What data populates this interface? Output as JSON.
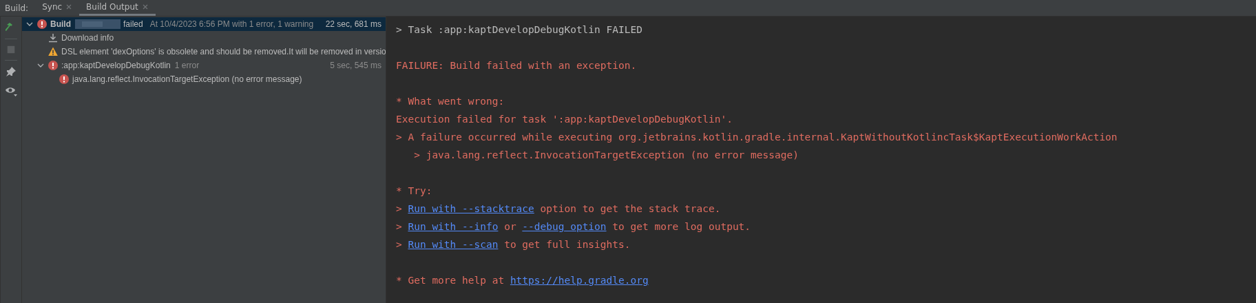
{
  "header": {
    "label": "Build:",
    "tabs": [
      {
        "label": "Sync",
        "selected": false
      },
      {
        "label": "Build Output",
        "selected": true
      }
    ]
  },
  "toolbar": [
    {
      "kind": "hammer"
    },
    {
      "kind": "stop"
    },
    {
      "kind": "pin"
    },
    {
      "kind": "eye"
    }
  ],
  "tree": [
    {
      "kind": "error",
      "title": "Build",
      "status": "failed",
      "detail": "At 10/4/2023 6:56 PM with 1 error, 1 warning",
      "time": "22 sec, 681 ms",
      "selected": true,
      "expanded": true,
      "children": [
        {
          "kind": "download",
          "title": "Download info",
          "selected": false
        },
        {
          "kind": "warning",
          "title": "DSL element 'dexOptions' is obsolete and should be removed.It will be removed in versio",
          "selected": false
        },
        {
          "kind": "error",
          "title": ":app:kaptDevelopDebugKotlin",
          "detail": "1 error",
          "time": "5 sec, 545 ms",
          "selected": false,
          "expanded": true,
          "children": [
            {
              "kind": "error",
              "title": "java.lang.reflect.InvocationTargetException (no error message)",
              "selected": false
            }
          ]
        }
      ]
    }
  ],
  "console": [
    {
      "kind": "info",
      "parts": [
        {
          "text": "> Task :app:kaptDevelopDebugKotlin FAILED",
          "link": false
        }
      ]
    },
    {
      "kind": "blank"
    },
    {
      "kind": "error",
      "parts": [
        {
          "text": "FAILURE: Build failed with an exception.",
          "link": false
        }
      ]
    },
    {
      "kind": "blank"
    },
    {
      "kind": "error",
      "parts": [
        {
          "text": "* What went wrong:",
          "link": false
        }
      ]
    },
    {
      "kind": "error",
      "parts": [
        {
          "text": "Execution failed for task ':app:kaptDevelopDebugKotlin'.",
          "link": false
        }
      ]
    },
    {
      "kind": "error",
      "parts": [
        {
          "text": "> A failure occurred while executing org.jetbrains.kotlin.gradle.internal.KaptWithoutKotlincTask$KaptExecutionWorkAction",
          "link": false
        }
      ]
    },
    {
      "kind": "error",
      "parts": [
        {
          "text": "   > java.lang.reflect.InvocationTargetException (no error message)",
          "link": false
        }
      ]
    },
    {
      "kind": "blank"
    },
    {
      "kind": "error",
      "parts": [
        {
          "text": "* Try:",
          "link": false
        }
      ]
    },
    {
      "kind": "error",
      "parts": [
        {
          "text": "> ",
          "link": false
        },
        {
          "text": "Run with --stacktrace",
          "link": true
        },
        {
          "text": " option to get the stack trace.",
          "link": false
        }
      ]
    },
    {
      "kind": "error",
      "parts": [
        {
          "text": "> ",
          "link": false
        },
        {
          "text": "Run with --info",
          "link": true
        },
        {
          "text": " or ",
          "link": false
        },
        {
          "text": "--debug option",
          "link": true
        },
        {
          "text": " to get more log output.",
          "link": false
        }
      ]
    },
    {
      "kind": "error",
      "parts": [
        {
          "text": "> ",
          "link": false
        },
        {
          "text": "Run with --scan",
          "link": true
        },
        {
          "text": " to get full insights.",
          "link": false
        }
      ]
    },
    {
      "kind": "blank"
    },
    {
      "kind": "error",
      "parts": [
        {
          "text": "* Get more help at ",
          "link": false
        },
        {
          "text": "https://help.gradle.org",
          "link": true
        }
      ]
    }
  ]
}
